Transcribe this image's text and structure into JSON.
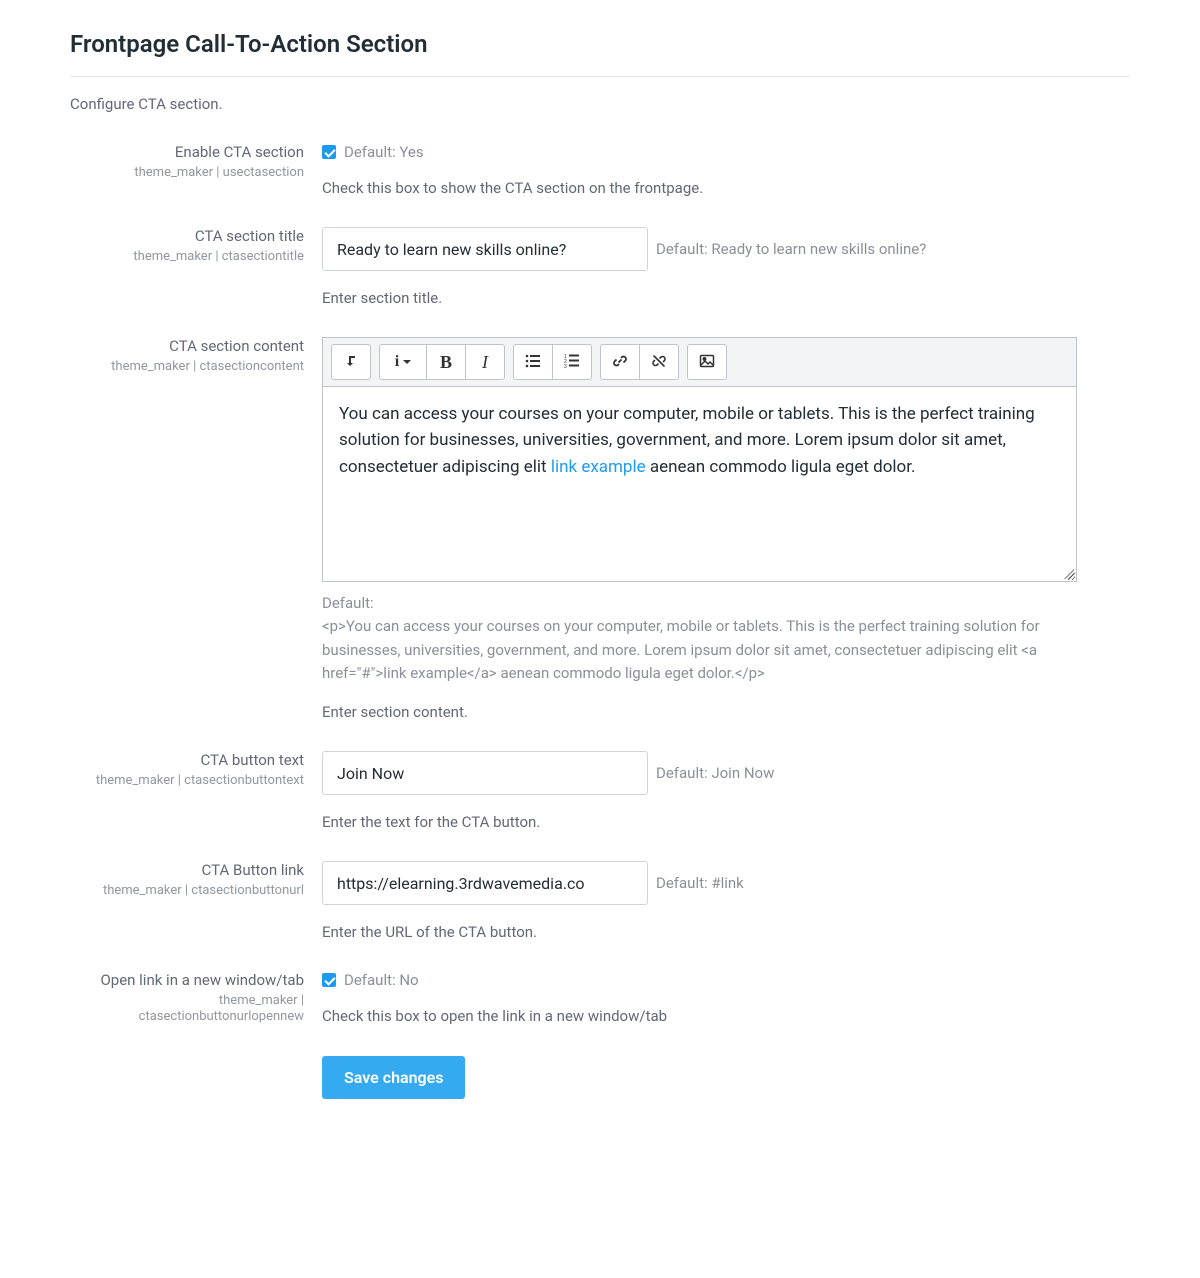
{
  "page": {
    "title": "Frontpage Call-To-Action Section",
    "description": "Configure CTA section."
  },
  "fields": {
    "enable": {
      "label": "Enable CTA section",
      "key": "theme_maker | usectasection",
      "checked": true,
      "default_text": "Default: Yes",
      "help": "Check this box to show the CTA section on the frontpage."
    },
    "section_title": {
      "label": "CTA section title",
      "key": "theme_maker | ctasectiontitle",
      "value": "Ready to learn new skills online?",
      "default_text": "Default: Ready to learn new skills online?",
      "help": "Enter section title."
    },
    "section_content": {
      "label": "CTA section content",
      "key": "theme_maker | ctasectioncontent",
      "value_before_link": "You can access your courses on your computer, mobile or tablets. This is the perfect training solution for businesses, universities, government, and more. Lorem ipsum dolor sit amet, consectetuer adipiscing elit ",
      "link_text": "link example",
      "value_after_link": " aenean commodo ligula eget dolor.",
      "default_label": "Default:",
      "default_value": "<p>You can access your courses on your computer, mobile or tablets. This is the perfect training solution for businesses, universities, government, and more. Lorem ipsum dolor sit amet, consectetuer adipiscing elit <a href=\"#\">link example</a> aenean commodo ligula eget dolor.</p>",
      "help": "Enter section content."
    },
    "button_text": {
      "label": "CTA button text",
      "key": "theme_maker | ctasectionbuttontext",
      "value": "Join Now",
      "default_text": "Default: Join Now",
      "help": "Enter the text for the CTA button."
    },
    "button_link": {
      "label": "CTA Button link",
      "key": "theme_maker | ctasectionbuttonurl",
      "value": "https://elearning.3rdwavemedia.co",
      "default_text": "Default: #link",
      "help": "Enter the URL of the CTA button."
    },
    "open_new": {
      "label": "Open link in a new window/tab",
      "key": "theme_maker | ctasectionbuttonurlopennew",
      "checked": true,
      "default_text": "Default: No",
      "help": "Check this box to open the link in a new window/tab"
    }
  },
  "actions": {
    "save": "Save changes"
  },
  "toolbar": {
    "toggle": "toggle",
    "styles": "styles",
    "bold": "B",
    "italic": "I",
    "ul": "ul",
    "ol": "ol",
    "link": "link",
    "unlink": "unlink",
    "image": "image"
  }
}
